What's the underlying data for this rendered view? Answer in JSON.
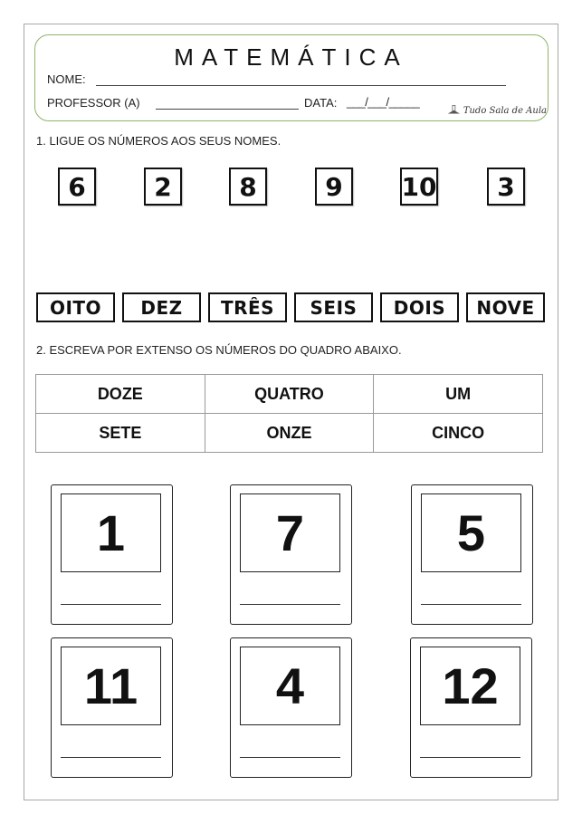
{
  "header": {
    "title": "MATEMÁTICA",
    "name_label": "NOME:",
    "teacher_label": "PROFESSOR (A)",
    "date_label": "DATA:",
    "date_slashes": "___/___/_____",
    "logo_text": "Tudo Sala de Aula",
    "border_color": "#8fb46a"
  },
  "exercise1": {
    "instruction": "1. LIGUE OS NÚMEROS AOS SEUS NOMES.",
    "numbers": [
      "6",
      "2",
      "8",
      "9",
      "10",
      "3"
    ],
    "words": [
      "OITO",
      "DEZ",
      "TRÊS",
      "SEIS",
      "DOIS",
      "NOVE"
    ]
  },
  "exercise2": {
    "instruction": "2. ESCREVA POR EXTENSO OS NÚMEROS DO QUADRO ABAIXO.",
    "table": [
      [
        "DOZE",
        "QUATRO",
        "UM"
      ],
      [
        "SETE",
        "ONZE",
        "CINCO"
      ]
    ],
    "cards": [
      "1",
      "7",
      "5",
      "11",
      "4",
      "12"
    ]
  }
}
